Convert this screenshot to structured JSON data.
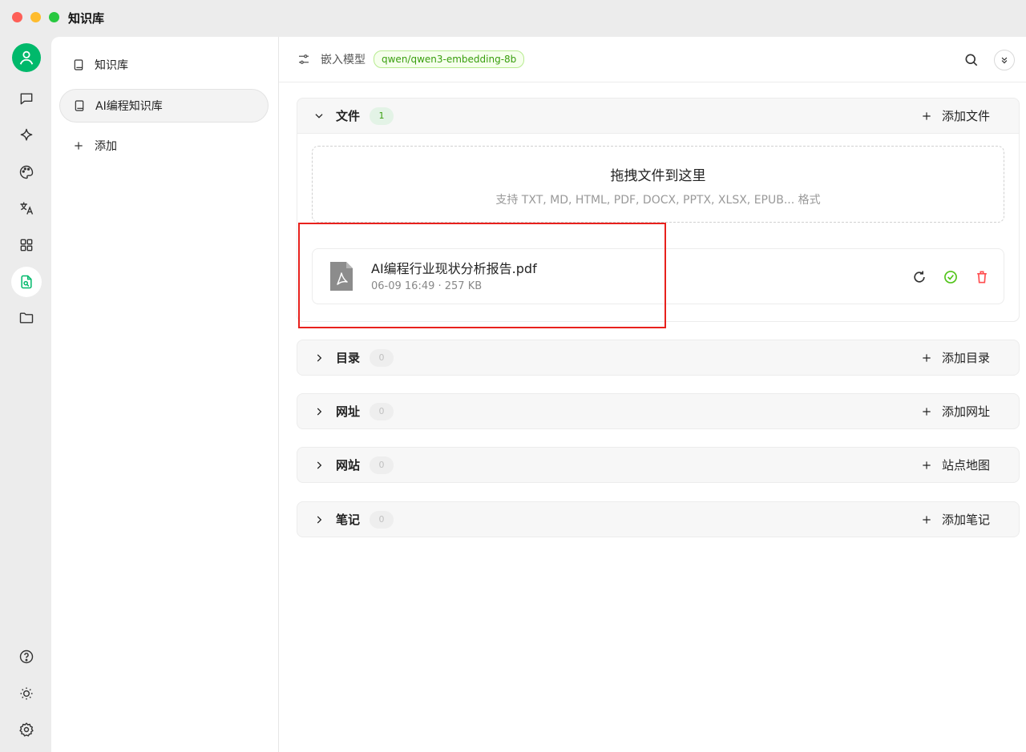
{
  "window": {
    "title": "知识库",
    "controls": [
      "close",
      "minimize",
      "zoom"
    ]
  },
  "rail": {
    "items": [
      {
        "icon": "avatar-icon"
      },
      {
        "icon": "chat-icon"
      },
      {
        "icon": "sparkle-icon"
      },
      {
        "icon": "palette-icon"
      },
      {
        "icon": "translate-icon"
      },
      {
        "icon": "apps-grid-icon"
      },
      {
        "icon": "knowledge-base-icon",
        "active": true
      },
      {
        "icon": "folder-icon"
      }
    ],
    "bottom": [
      {
        "icon": "help-icon"
      },
      {
        "icon": "theme-icon"
      },
      {
        "icon": "settings-icon"
      }
    ]
  },
  "sidebar": {
    "items": [
      {
        "label": "知识库",
        "icon": "book-icon"
      },
      {
        "label": "AI编程知识库",
        "icon": "book-icon",
        "active": true
      }
    ],
    "add_label": "添加"
  },
  "header": {
    "embed_label": "嵌入模型",
    "model": "qwen/qwen3-embedding-8b"
  },
  "sections": {
    "files": {
      "title": "文件",
      "count": "1",
      "action": "添加文件"
    },
    "directory": {
      "title": "目录",
      "count": "0",
      "action": "添加目录"
    },
    "url": {
      "title": "网址",
      "count": "0",
      "action": "添加网址"
    },
    "website": {
      "title": "网站",
      "count": "0",
      "action": "站点地图"
    },
    "notes": {
      "title": "笔记",
      "count": "0",
      "action": "添加笔记"
    }
  },
  "dropzone": {
    "title": "拖拽文件到这里",
    "subtitle": "支持 TXT, MD, HTML, PDF, DOCX, PPTX, XLSX, EPUB... 格式"
  },
  "file": {
    "name": "AI编程行业现状分析报告.pdf",
    "meta": "06-09 16:49 · 257 KB",
    "icon": "pdf-file-icon"
  },
  "colors": {
    "accent": "#00b96b",
    "success": "#52c41a",
    "danger": "#ff4d4f",
    "highlight": "#e8211d"
  }
}
